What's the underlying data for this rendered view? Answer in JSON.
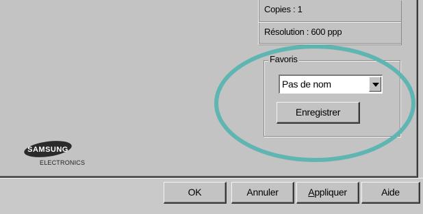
{
  "info": {
    "copies": "Copies : 1",
    "resolution": "Résolution : 600 ppp"
  },
  "favorites": {
    "legend": "Favoris",
    "selected": "Pas de nom",
    "save_label": "Enregistrer"
  },
  "logo": {
    "brand": "SAMSUNG",
    "sub": "ELECTRONICS"
  },
  "footer": {
    "ok_label": "OK",
    "cancel_label": "Annuler",
    "apply_label": "Appliquer",
    "help_label": "Aide"
  },
  "colors": {
    "highlight": "#5fb5b1",
    "panel": "#c3c3c3"
  }
}
